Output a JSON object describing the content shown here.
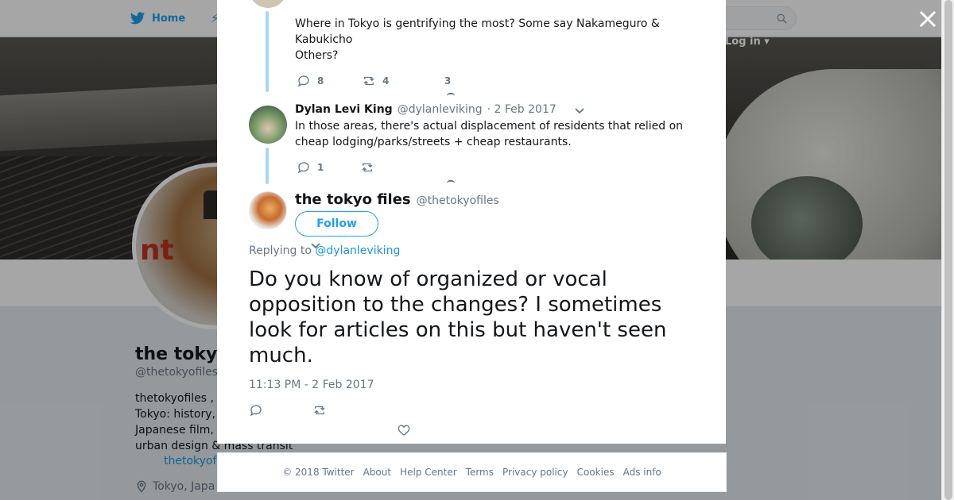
{
  "topbar": {
    "home_label": "Home",
    "login_label": "Log in ▾"
  },
  "profile": {
    "name": "the tokyo",
    "handle": "@thetokyofiles",
    "bio_lines": [
      "thetokyofiles ,",
      "Tokyo: history,",
      "Japanese film,",
      "urban design & mass transit"
    ],
    "link": "thetokyof",
    "location": "Tokyo, Japa"
  },
  "thread": {
    "first_tweet": {
      "text_lines": [
        "Where in Tokyo is gentrifying the most? Some say Nakameguro &",
        "Kabukicho",
        "Others?"
      ],
      "replies": "8",
      "retweets": "4",
      "likes": "3"
    },
    "second_tweet": {
      "name": "Dylan Levi King",
      "handle": "@dylanleviking",
      "date": "· 2 Feb 2017",
      "text_lines": [
        "In those areas, there's actual displacement of residents that relied on",
        "cheap lodging/parks/streets + cheap restaurants."
      ],
      "replies": "1"
    }
  },
  "main_tweet": {
    "name": "the tokyo files",
    "handle": "@thetokyofiles",
    "follow_label": "Follow",
    "replying_prefix": "Replying to",
    "replying_to": "@dylanleviking",
    "text": "Do you know of organized or vocal opposition to the changes? I sometimes look for articles on this but haven't seen much.",
    "timestamp": "11:13 PM - 2 Feb 2017"
  },
  "footer": {
    "items": [
      "© 2018 Twitter",
      "About",
      "Help Center",
      "Terms",
      "Privacy policy",
      "Cookies",
      "Ads info"
    ]
  },
  "colors": {
    "accent": "#1da1f2",
    "thread_line": "#a5d7f6",
    "muted": "#657786"
  }
}
